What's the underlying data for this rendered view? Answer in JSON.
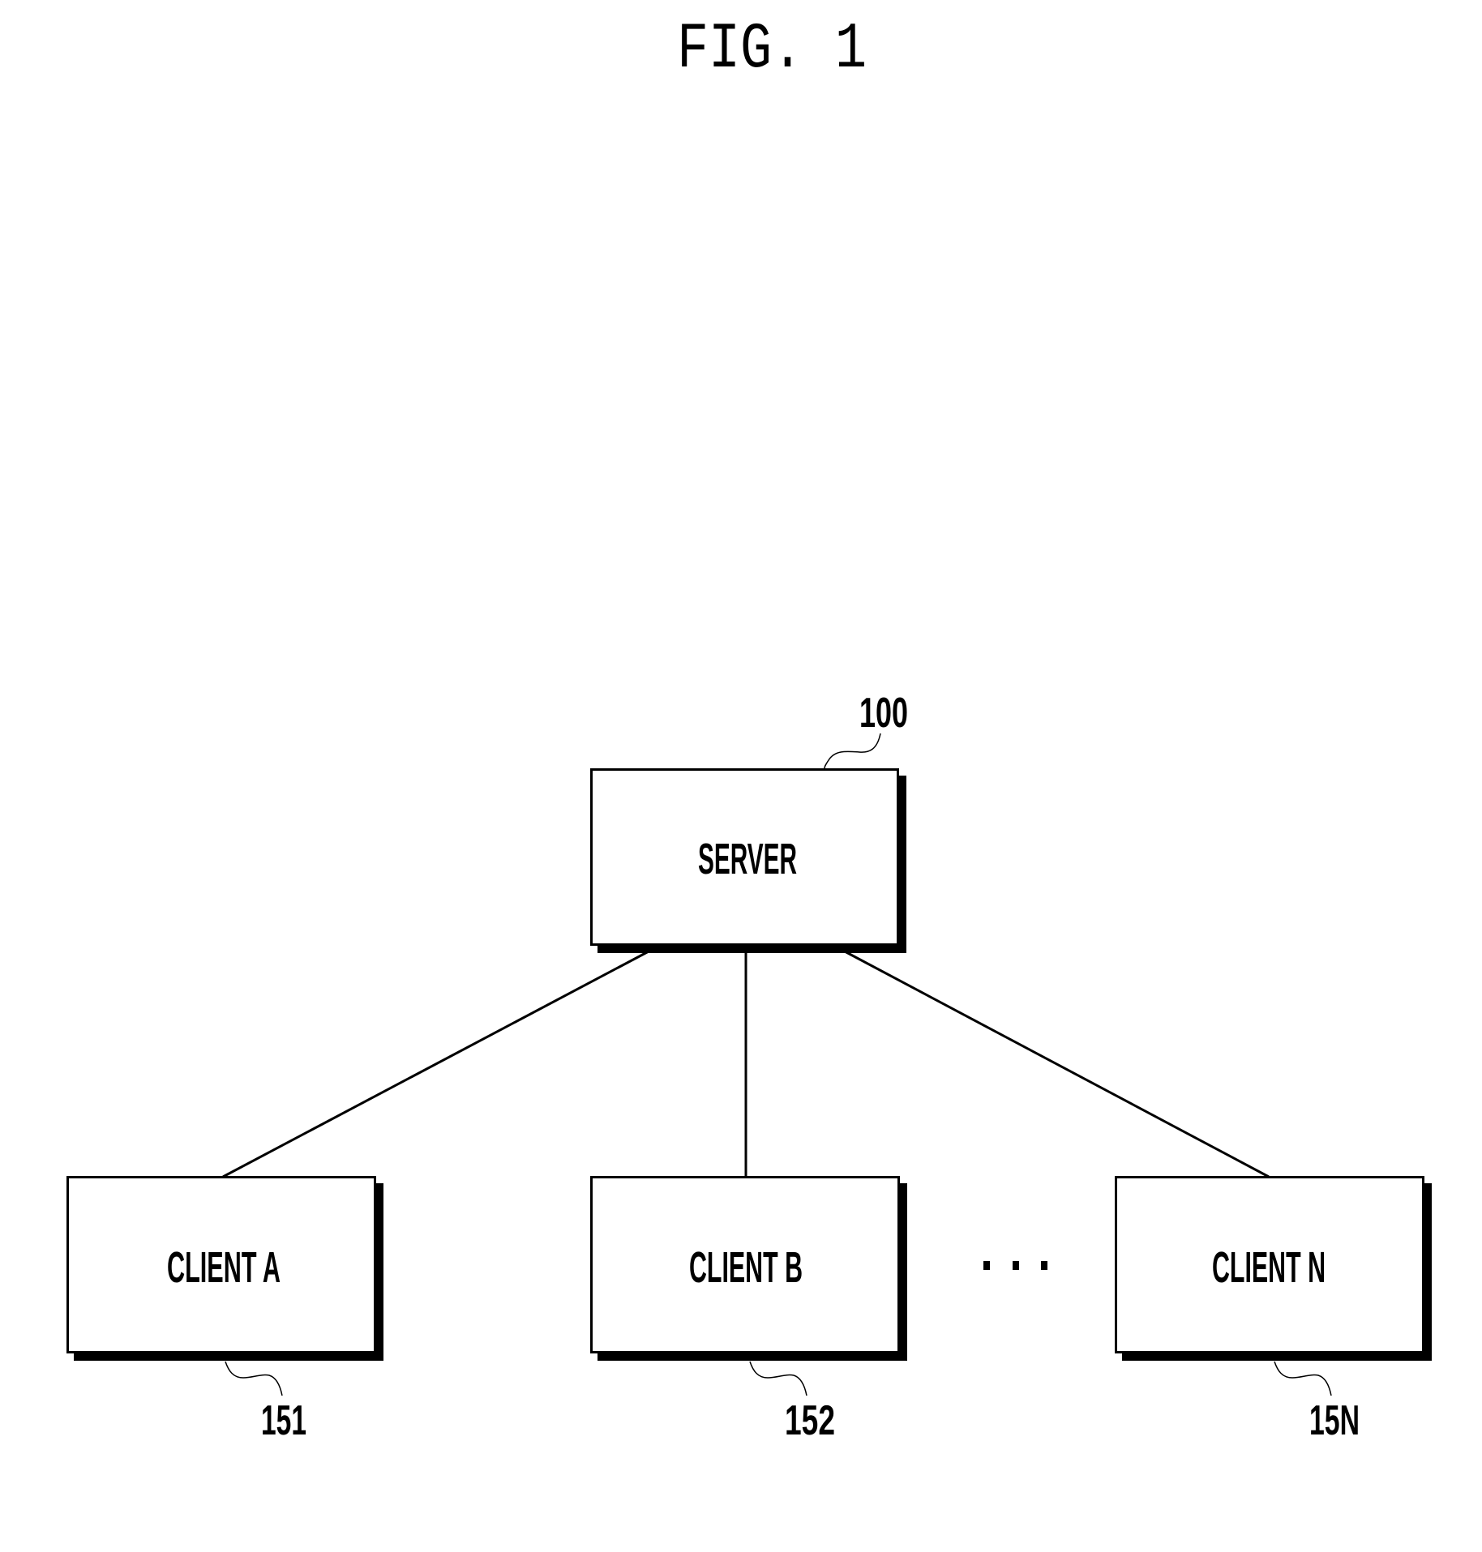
{
  "figure": {
    "title": "FIG. 1"
  },
  "server": {
    "label": "SERVER",
    "ref": "100"
  },
  "clients": [
    {
      "label": "CLIENT A",
      "ref": "151"
    },
    {
      "label": "CLIENT B",
      "ref": "152"
    },
    {
      "label": "CLIENT N",
      "ref": "15N"
    }
  ],
  "ellipsis": "...",
  "connections": [
    {
      "from": "SERVER",
      "to": "CLIENT A"
    },
    {
      "from": "SERVER",
      "to": "CLIENT B"
    },
    {
      "from": "SERVER",
      "to": "CLIENT N"
    }
  ],
  "colors": {
    "ink": "#000000",
    "background": "#ffffff"
  }
}
